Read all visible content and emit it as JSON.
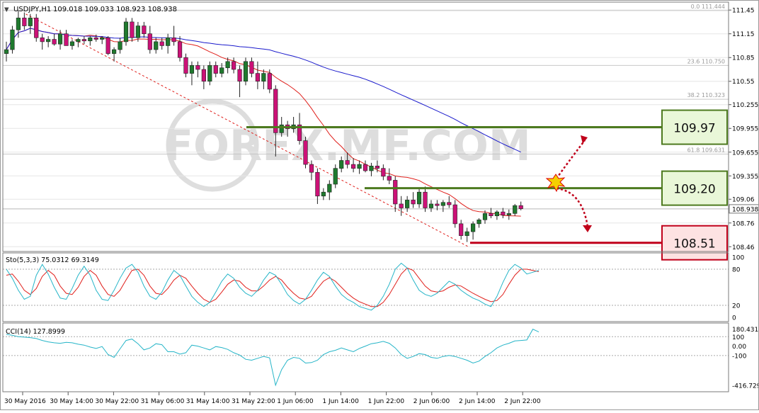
{
  "chart_data": {
    "type": "candlestick",
    "symbol_header": "USDJPY,H1",
    "ohlc_header": "109.018 109.033 108.923 108.938",
    "current_price": 108.938,
    "price_axis": {
      "range": [
        108.4,
        111.55
      ],
      "ticks": [
        111.45,
        111.15,
        110.85,
        110.55,
        110.255,
        109.955,
        109.655,
        109.355,
        109.06,
        108.76,
        108.46
      ]
    },
    "x_labels": [
      "30 May 2016",
      "30 May 14:00",
      "30 May 22:00",
      "31 May 06:00",
      "31 May 14:00",
      "31 May 22:00",
      "1 Jun 06:00",
      "1 Jun 14:00",
      "1 Jun 22:00",
      "2 Jun 06:00",
      "2 Jun 14:00",
      "2 Jun 22:00"
    ],
    "fibonacci": [
      {
        "label": "0.0",
        "value": 111.444
      },
      {
        "label": "23.6",
        "value": 110.75
      },
      {
        "label": "38.2",
        "value": 110.323
      },
      {
        "label": "61.8",
        "value": 109.631
      }
    ],
    "levels": [
      {
        "label": "109.97",
        "value": 109.97,
        "color": "#4d7a1f",
        "box_fill": "#e9f7d8",
        "role": "resistance"
      },
      {
        "label": "109.20",
        "value": 109.2,
        "color": "#4d7a1f",
        "box_fill": "#e9f7d8",
        "role": "resistance"
      },
      {
        "label": "108.51",
        "value": 108.51,
        "color": "#c0001a",
        "box_fill": "#fde2e2",
        "role": "support"
      }
    ],
    "colors": {
      "bull": "#1f7a2e",
      "bear": "#cc1177",
      "ma_fast": "#e0201c",
      "ma_slow": "#1a1acc",
      "trend": "#e0201c",
      "sto_main": "#26b5c8",
      "sto_signal": "#e0201c",
      "cci": "#26b5c8",
      "arrow": "#c0001a",
      "burst": "#f4d000"
    },
    "candles": [
      [
        110.9,
        111.05,
        110.8,
        110.95
      ],
      [
        110.95,
        111.25,
        110.9,
        111.2
      ],
      [
        111.2,
        111.45,
        111.1,
        111.35
      ],
      [
        111.35,
        111.42,
        111.2,
        111.25
      ],
      [
        111.25,
        111.4,
        111.15,
        111.35
      ],
      [
        111.35,
        111.4,
        111.05,
        111.1
      ],
      [
        111.1,
        111.15,
        110.95,
        111.05
      ],
      [
        111.05,
        111.12,
        110.98,
        111.08
      ],
      [
        111.08,
        111.15,
        111.0,
        111.02
      ],
      [
        111.02,
        111.2,
        110.95,
        111.15
      ],
      [
        111.15,
        111.2,
        111.05,
        111.0
      ],
      [
        111.0,
        111.08,
        110.95,
        111.05
      ],
      [
        111.05,
        111.1,
        110.98,
        111.08
      ],
      [
        111.08,
        111.12,
        111.02,
        111.06
      ],
      [
        111.06,
        111.12,
        111.0,
        111.1
      ],
      [
        111.1,
        111.14,
        111.05,
        111.08
      ],
      [
        111.08,
        111.12,
        111.02,
        111.1
      ],
      [
        111.1,
        111.12,
        110.88,
        110.9
      ],
      [
        110.9,
        110.98,
        110.8,
        110.95
      ],
      [
        110.95,
        111.1,
        110.9,
        111.05
      ],
      [
        111.05,
        111.35,
        111.0,
        111.3
      ],
      [
        111.3,
        111.35,
        111.05,
        111.1
      ],
      [
        111.1,
        111.3,
        111.05,
        111.25
      ],
      [
        111.25,
        111.3,
        111.1,
        111.15
      ],
      [
        111.15,
        111.25,
        110.9,
        110.95
      ],
      [
        110.95,
        111.1,
        110.9,
        111.05
      ],
      [
        111.05,
        111.1,
        110.95,
        111.0
      ],
      [
        111.0,
        111.15,
        110.9,
        111.1
      ],
      [
        111.1,
        111.25,
        111.0,
        111.05
      ],
      [
        111.05,
        111.12,
        110.8,
        110.85
      ],
      [
        110.85,
        110.9,
        110.6,
        110.65
      ],
      [
        110.65,
        110.8,
        110.5,
        110.75
      ],
      [
        110.75,
        110.8,
        110.6,
        110.7
      ],
      [
        110.7,
        110.75,
        110.45,
        110.55
      ],
      [
        110.55,
        110.8,
        110.5,
        110.75
      ],
      [
        110.75,
        110.8,
        110.6,
        110.65
      ],
      [
        110.65,
        110.78,
        110.6,
        110.72
      ],
      [
        110.72,
        110.85,
        110.65,
        110.8
      ],
      [
        110.8,
        110.85,
        110.65,
        110.7
      ],
      [
        110.7,
        110.75,
        110.35,
        110.55
      ],
      [
        110.55,
        110.85,
        110.5,
        110.8
      ],
      [
        110.8,
        110.85,
        110.6,
        110.65
      ],
      [
        110.65,
        110.8,
        110.45,
        110.55
      ],
      [
        110.55,
        110.7,
        110.45,
        110.65
      ],
      [
        110.65,
        110.7,
        110.4,
        110.45
      ],
      [
        110.45,
        110.5,
        109.6,
        109.9
      ],
      [
        109.9,
        110.1,
        109.85,
        110.0
      ],
      [
        110.0,
        110.05,
        109.85,
        109.95
      ],
      [
        109.95,
        110.1,
        109.9,
        110.0
      ],
      [
        110.0,
        110.15,
        109.75,
        109.8
      ],
      [
        109.8,
        109.85,
        109.45,
        109.5
      ],
      [
        109.5,
        109.55,
        109.3,
        109.4
      ],
      [
        109.4,
        109.45,
        109.0,
        109.1
      ],
      [
        109.1,
        109.2,
        109.05,
        109.15
      ],
      [
        109.15,
        109.3,
        109.05,
        109.25
      ],
      [
        109.25,
        109.5,
        109.2,
        109.45
      ],
      [
        109.45,
        109.6,
        109.4,
        109.55
      ],
      [
        109.55,
        109.65,
        109.45,
        109.5
      ],
      [
        109.5,
        109.58,
        109.4,
        109.45
      ],
      [
        109.45,
        109.55,
        109.38,
        109.5
      ],
      [
        109.5,
        109.55,
        109.4,
        109.42
      ],
      [
        109.42,
        109.52,
        109.35,
        109.48
      ],
      [
        109.48,
        109.55,
        109.4,
        109.45
      ],
      [
        109.45,
        109.5,
        109.3,
        109.35
      ],
      [
        109.35,
        109.45,
        109.25,
        109.3
      ],
      [
        109.3,
        109.35,
        108.9,
        109.0
      ],
      [
        109.0,
        109.1,
        108.85,
        108.95
      ],
      [
        108.95,
        109.1,
        108.9,
        109.05
      ],
      [
        109.05,
        109.15,
        108.95,
        109.0
      ],
      [
        109.0,
        109.2,
        108.95,
        109.15
      ],
      [
        109.15,
        109.22,
        108.9,
        108.95
      ],
      [
        108.95,
        109.05,
        108.9,
        109.0
      ],
      [
        109.0,
        109.05,
        108.92,
        108.98
      ],
      [
        108.98,
        109.05,
        108.9,
        109.02
      ],
      [
        109.02,
        109.1,
        108.95,
        108.99
      ],
      [
        108.99,
        109.05,
        108.7,
        108.75
      ],
      [
        108.75,
        108.8,
        108.55,
        108.6
      ],
      [
        108.6,
        108.7,
        108.52,
        108.65
      ],
      [
        108.65,
        108.78,
        108.55,
        108.75
      ],
      [
        108.75,
        108.82,
        108.7,
        108.8
      ],
      [
        108.8,
        108.92,
        108.75,
        108.88
      ],
      [
        108.88,
        108.95,
        108.82,
        108.85
      ],
      [
        108.85,
        108.92,
        108.8,
        108.9
      ],
      [
        108.9,
        108.95,
        108.82,
        108.86
      ],
      [
        108.86,
        108.93,
        108.8,
        108.88
      ],
      [
        108.88,
        109.0,
        108.85,
        108.98
      ],
      [
        108.98,
        109.03,
        108.92,
        108.94
      ]
    ]
  },
  "indicators": {
    "sto": {
      "header": "Sto(5,3,3) 75.0312 69.3149",
      "axis": {
        "range": [
          0,
          100
        ],
        "ticks": [
          "100",
          "80",
          "20",
          "0"
        ]
      },
      "main": [
        80,
        65,
        45,
        30,
        35,
        70,
        88,
        72,
        50,
        32,
        30,
        48,
        70,
        85,
        70,
        45,
        30,
        28,
        45,
        65,
        82,
        88,
        75,
        52,
        35,
        30,
        42,
        62,
        78,
        70,
        52,
        35,
        25,
        18,
        25,
        42,
        60,
        72,
        65,
        50,
        40,
        35,
        45,
        62,
        75,
        70,
        55,
        38,
        28,
        22,
        30,
        45,
        62,
        75,
        68,
        52,
        38,
        30,
        25,
        18,
        15,
        12,
        20,
        35,
        55,
        80,
        90,
        82,
        62,
        45,
        38,
        35,
        40,
        50,
        60,
        55,
        45,
        38,
        32,
        28,
        22,
        18,
        35,
        58,
        78,
        88,
        82,
        72,
        75,
        78
      ],
      "signal": [
        70,
        72,
        60,
        45,
        38,
        48,
        68,
        78,
        70,
        52,
        40,
        38,
        50,
        68,
        78,
        70,
        52,
        38,
        35,
        45,
        62,
        78,
        80,
        70,
        52,
        40,
        38,
        48,
        62,
        70,
        65,
        52,
        40,
        30,
        25,
        30,
        42,
        55,
        62,
        60,
        50,
        44,
        44,
        52,
        62,
        68,
        62,
        50,
        40,
        32,
        30,
        35,
        48,
        60,
        66,
        60,
        50,
        40,
        32,
        26,
        22,
        18,
        18,
        25,
        38,
        55,
        72,
        82,
        78,
        65,
        52,
        44,
        42,
        44,
        50,
        54,
        52,
        46,
        40,
        35,
        30,
        26,
        28,
        38,
        55,
        70,
        80,
        80,
        78,
        76
      ]
    },
    "cci": {
      "header": "CCI(14) 127.8999",
      "axis": {
        "range": [
          -440,
          200
        ],
        "ticks": [
          "180.4314",
          "100",
          "0.00",
          "-100",
          "-416.7297"
        ]
      },
      "values": [
        125,
        115,
        100,
        95,
        90,
        80,
        60,
        45,
        35,
        30,
        40,
        35,
        20,
        10,
        -10,
        -25,
        -5,
        -90,
        -120,
        -30,
        60,
        75,
        25,
        -40,
        -20,
        25,
        15,
        -60,
        -60,
        -85,
        -70,
        10,
        0,
        -20,
        -40,
        -5,
        -15,
        -35,
        -70,
        -95,
        -140,
        -150,
        -130,
        -110,
        -125,
        -416,
        -250,
        -150,
        -120,
        -130,
        -180,
        -175,
        -150,
        -90,
        -60,
        -45,
        -20,
        -40,
        -60,
        -25,
        0,
        25,
        35,
        50,
        30,
        -20,
        -90,
        -130,
        -110,
        -80,
        -90,
        -120,
        -130,
        -110,
        -100,
        -110,
        -130,
        -150,
        -180,
        -160,
        -110,
        -70,
        -20,
        10,
        30,
        55,
        60,
        65,
        180,
        150
      ]
    }
  }
}
